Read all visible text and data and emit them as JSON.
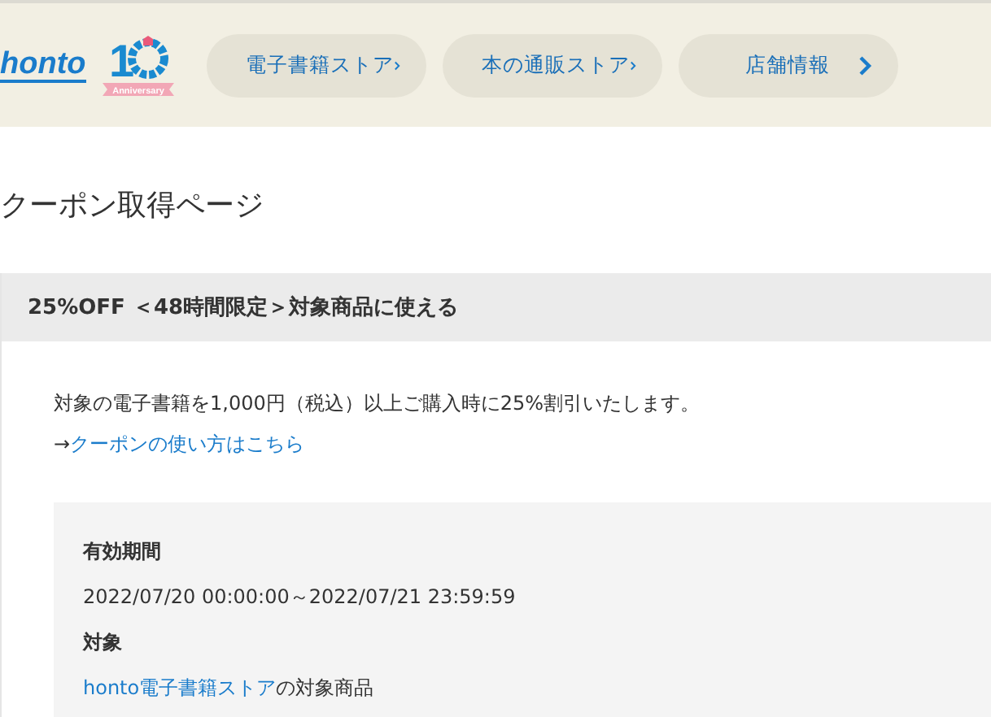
{
  "header": {
    "logo": "honto",
    "badge": {
      "number": "1",
      "ribbon": "Anniversary"
    },
    "nav": [
      {
        "label": "電子書籍ストア"
      },
      {
        "label": "本の通販ストア"
      },
      {
        "label": "店舗情報"
      }
    ]
  },
  "page_title": "クーポン取得ページ",
  "coupon": {
    "title": "25%OFF ＜48時間限定＞対象商品に使える",
    "description": "対象の電子書籍を1,000円（税込）以上ご購入時に25%割引いたします。",
    "howto": {
      "arrow": "→",
      "link": "クーポンの使い方はこちら"
    },
    "details": [
      {
        "label": "有効期間",
        "value": "2022/07/20 00:00:00～2022/07/21 23:59:59"
      },
      {
        "label": "対象",
        "link": "honto電子書籍ストア",
        "value": "の対象商品"
      }
    ]
  }
}
